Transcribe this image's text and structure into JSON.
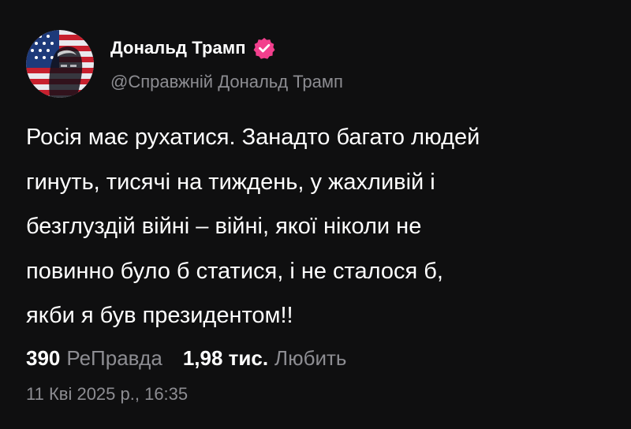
{
  "author": {
    "display_name": "Дональд Трамп",
    "handle": "@Справжній Дональд Трамп",
    "avatar_icon": "flag-portrait-avatar",
    "verified_icon": "verified-badge-icon",
    "verified_color": "#f23f8d"
  },
  "post": {
    "text": "Росія має рухатися. Занадто багато людей\nгинуть, тисячі на тиждень, у жахливій і\nбезглуздій війні – війні, якої ніколи не\nповинно було б статися, і не сталося б,\nякби я був президентом!!"
  },
  "stats": {
    "reposts_count": "390",
    "reposts_label": "РеПравда",
    "likes_count": "1,98 тис.",
    "likes_label": "Любить"
  },
  "timestamp": "11 Кві 2025 р., 16:35"
}
